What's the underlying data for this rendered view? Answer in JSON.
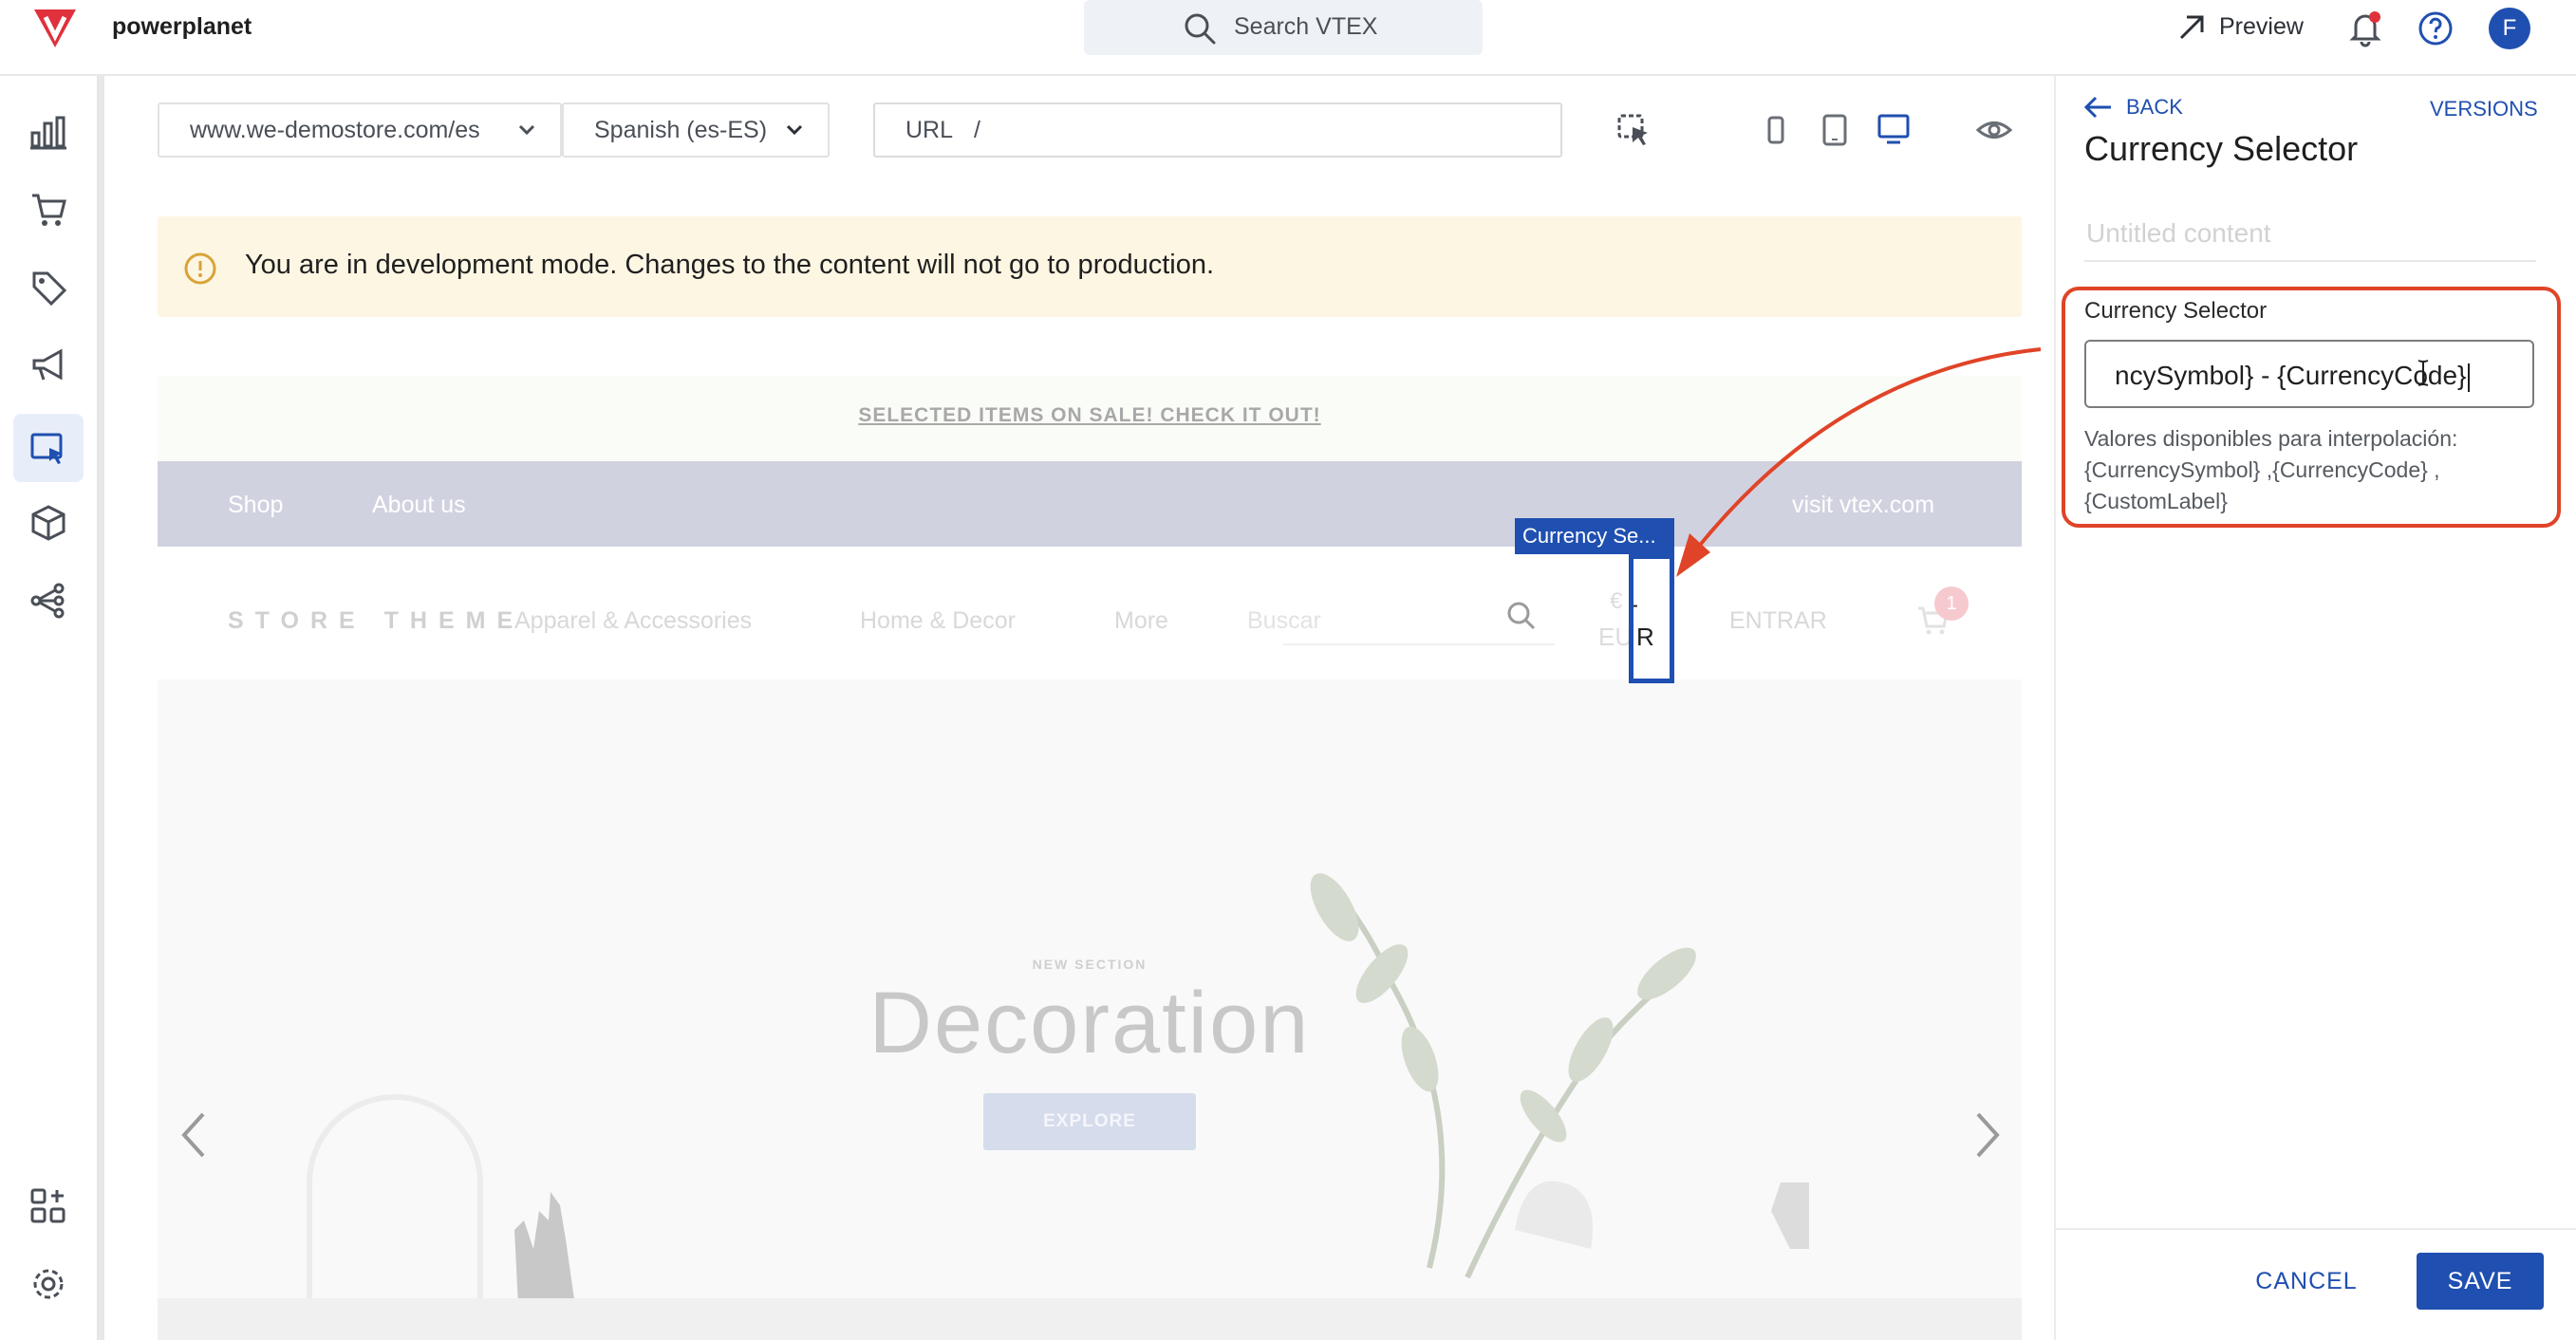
{
  "topbar": {
    "account_name": "powerplanet",
    "search_label": "Search VTEX",
    "preview_label": "Preview",
    "avatar_letter": "F"
  },
  "toolbar": {
    "binding_selected": "www.we-demostore.com/es",
    "locale_selected": "Spanish (es-ES)",
    "url_label": "URL",
    "url_value": "/"
  },
  "banner": {
    "message": "You are in development mode. Changes to the content will not go to production."
  },
  "store": {
    "promo": "SELECTED ITEMS ON SALE! CHECK IT OUT!",
    "nav_links": [
      "Shop",
      "About us"
    ],
    "nav_right": "visit vtex.com",
    "logo": "STORE THEME",
    "menu": [
      "Apparel & Accessories",
      "Home & Decor",
      "More"
    ],
    "search_placeholder": "Buscar",
    "currency_symbol": "€",
    "currency_dash": "-",
    "currency_code_start": "EU",
    "currency_code_end": "R",
    "login": "ENTRAR",
    "cart_count": "1",
    "hero_kicker": "NEW SECTION",
    "hero_title": "Decoration",
    "hero_button": "EXPLORE"
  },
  "highlight": {
    "tag": "Currency Se..."
  },
  "panel": {
    "back": "BACK",
    "versions": "VERSIONS",
    "title": "Currency Selector",
    "content_name_placeholder": "Untitled content",
    "field_label": "Currency Selector",
    "field_value": "ncySymbol} - {CurrencyCode}",
    "field_help": "Valores disponibles para interpolación: {CurrencySymbol} ,{CurrencyCode} ,{CustomLabel}",
    "cancel": "CANCEL",
    "save": "SAVE"
  },
  "colors": {
    "accent": "#1f4fb0",
    "brand": "#e0313c",
    "annotation": "#e04428",
    "warning": "#d9a33a"
  }
}
